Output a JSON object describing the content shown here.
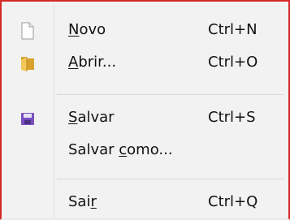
{
  "menu": {
    "items": [
      {
        "id": "novo",
        "label_pre": "",
        "mnemonic": "N",
        "label_post": "ovo",
        "shortcut": "Ctrl+N",
        "icon": "new-file-icon"
      },
      {
        "id": "abrir",
        "label_pre": "",
        "mnemonic": "A",
        "label_post": "brir...",
        "shortcut": "Ctrl+O",
        "icon": "folder-open-icon"
      },
      {
        "id": "salvar",
        "label_pre": "",
        "mnemonic": "S",
        "label_post": "alvar",
        "shortcut": "Ctrl+S",
        "icon": "floppy-disk-icon"
      },
      {
        "id": "salvar-como",
        "label_pre": "Salvar ",
        "mnemonic": "c",
        "label_post": "omo...",
        "shortcut": "",
        "icon": ""
      },
      {
        "id": "sair",
        "label_pre": "Sai",
        "mnemonic": "r",
        "label_post": "",
        "shortcut": "Ctrl+Q",
        "icon": ""
      }
    ]
  },
  "colors": {
    "border_accent": "#d62828",
    "menu_background": "#f2f2f2",
    "separator": "#d7d7d7",
    "folder": "#e3b23c",
    "floppy": "#7a4fc0"
  }
}
